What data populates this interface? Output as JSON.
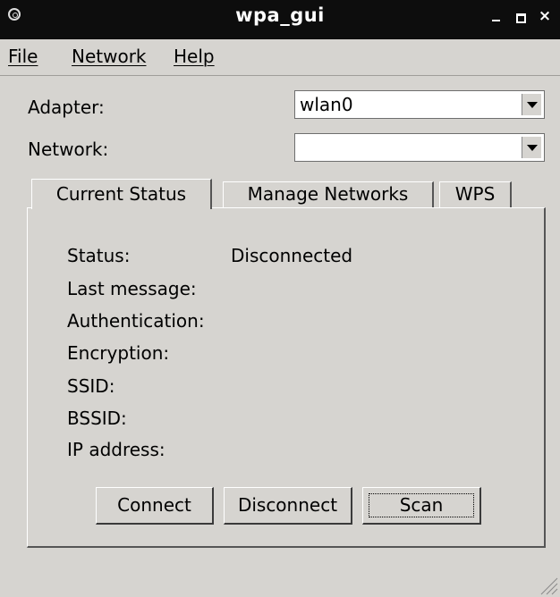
{
  "window": {
    "title": "wpa_gui"
  },
  "menu": {
    "items": [
      "File",
      "Network",
      "Help"
    ]
  },
  "adapter": {
    "label": "Adapter:",
    "value": "wlan0"
  },
  "network": {
    "label": "Network:",
    "value": ""
  },
  "tabs": [
    {
      "label": "Current Status",
      "active": true
    },
    {
      "label": "Manage Networks",
      "active": false
    },
    {
      "label": "WPS",
      "active": false
    }
  ],
  "status": {
    "fields": [
      {
        "label": "Status:",
        "value": "Disconnected"
      },
      {
        "label": "Last message:",
        "value": ""
      },
      {
        "label": "Authentication:",
        "value": ""
      },
      {
        "label": "Encryption:",
        "value": ""
      },
      {
        "label": "SSID:",
        "value": ""
      },
      {
        "label": "BSSID:",
        "value": ""
      },
      {
        "label": "IP address:",
        "value": ""
      }
    ]
  },
  "buttons": {
    "connect": "Connect",
    "disconnect": "Disconnect",
    "scan": "Scan"
  },
  "icons": {
    "app": "wifi-app-icon",
    "minimize": "minimize-icon",
    "maximize": "maximize-icon",
    "close": "close-icon",
    "resize": "resize-grip-icon"
  },
  "colors": {
    "titlebar": "#0d0d0d",
    "window_bg": "#d6d4d0",
    "field_bg": "#ffffff"
  }
}
